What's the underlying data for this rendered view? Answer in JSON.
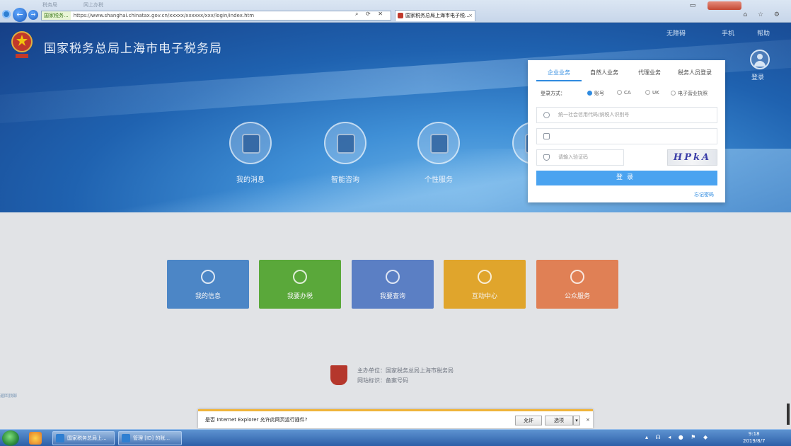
{
  "browser": {
    "ghost_tabs": [
      "税务局",
      "网上办税"
    ],
    "address": {
      "site_label": "国家税务...",
      "url": "https://www.shanghai.chinatax.gov.cn/xxxxx/xxxxxx/xxx/login/index.htm"
    },
    "active_tab": "国家税务总局上海市电子税...",
    "tab_close": "×"
  },
  "header": {
    "site_title": "国家税务总局上海市电子税务局",
    "top_links": [
      "无障碍",
      "手机",
      "帮助"
    ],
    "user_label": "登录"
  },
  "services": [
    {
      "label": "我的消息"
    },
    {
      "label": "智能咨询"
    },
    {
      "label": "个性服务"
    }
  ],
  "login": {
    "tabs": [
      "企业业务",
      "自然人业务",
      "代理业务",
      "税务人员登录"
    ],
    "active_tab": 0,
    "login_type_label": "登录方式：",
    "login_types": [
      "账号",
      "CA",
      "UK",
      "电子营业执照"
    ],
    "username_placeholder": "统一社会信用代码/纳税人识别号",
    "password_placeholder": "",
    "captcha_placeholder": "请输入验证码",
    "captcha_text": "HPkA",
    "submit_label": "登录",
    "forgot_label": "忘记密码"
  },
  "tiles": [
    {
      "label": "我的信息",
      "color": "#4c86c6"
    },
    {
      "label": "我要办税",
      "color": "#5aa83a"
    },
    {
      "label": "我要查询",
      "color": "#5b7fc4"
    },
    {
      "label": "互动中心",
      "color": "#e0a52c"
    },
    {
      "label": "公众服务",
      "color": "#e08055"
    }
  ],
  "footer": {
    "line1": "主办单位：国家税务总局上海市税务局",
    "line2": "网站标识：备案号码"
  },
  "side_note": "返回顶部",
  "download_bar": {
    "message": "是否 Internet Explorer 允许此网页运行插件?",
    "allow": "允许",
    "options": "选项",
    "dropdown": "▾",
    "close": "×"
  },
  "taskbar": {
    "tasks": [
      "国家税务总局上...",
      "管理 [ID] 的账..."
    ],
    "clock_time": "9:18",
    "clock_date": "2019/8/7"
  }
}
